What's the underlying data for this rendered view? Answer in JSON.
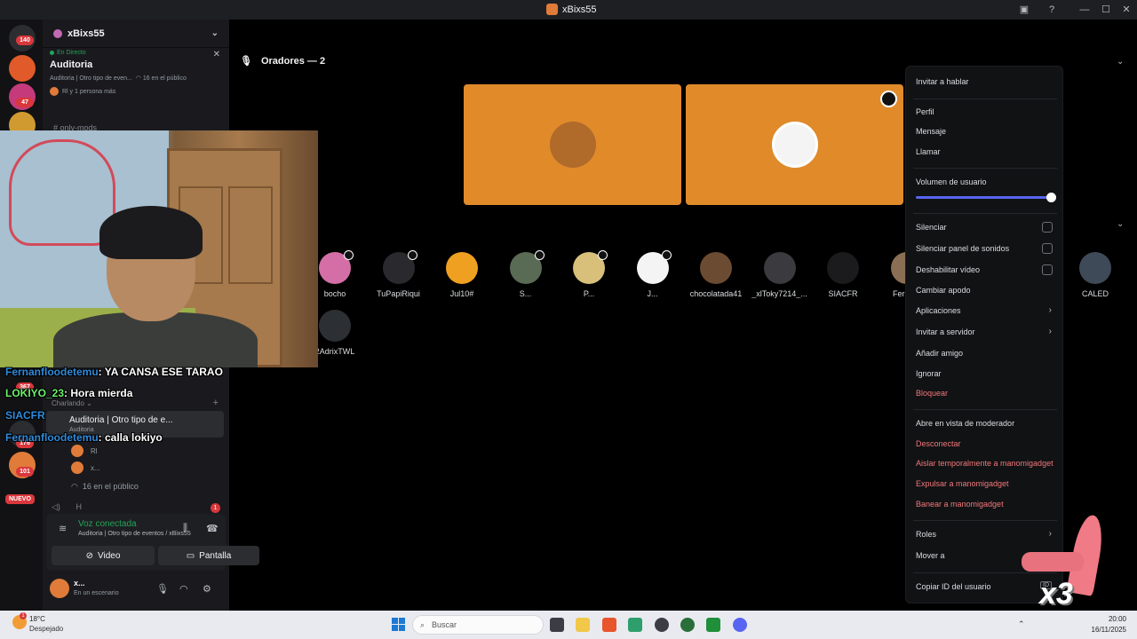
{
  "window": {
    "title": "xBixs55"
  },
  "rail": {
    "badges": [
      "140",
      "47",
      "367",
      "176",
      "101"
    ],
    "new_label": "NUEVO"
  },
  "sidebar": {
    "server_name": "xBixs55",
    "live": {
      "tag": "En Directo",
      "name": "Auditoria",
      "sub": "Auditoria | Otro tipo de even...",
      "listeners": "16 en el público",
      "people": "Rl y 1 persona más"
    },
    "channel_only_mods": "only-mods",
    "section_charlando": "Charlando",
    "stage_channel": {
      "name": "Auditoria | Otro tipo de e...",
      "sub": "Auditoria"
    },
    "users": [
      "Rl",
      "x..."
    ],
    "audience_count": "16 en el público",
    "last_channel": "H",
    "last_badge": "1"
  },
  "voice": {
    "title": "Voz conectada",
    "desc": "Auditoria | Otro tipo de eventos / xBixs55",
    "video_label": "Video",
    "screen_label": "Pantalla"
  },
  "user": {
    "name": "x...",
    "status": "En un escenario"
  },
  "stage": {
    "speakers_header": "Oradores — 2"
  },
  "audience": [
    {
      "name": "bocho",
      "color": "#d46ea6"
    },
    {
      "name": "TuPapiRiqui",
      "color": "#2a2a2e"
    },
    {
      "name": "Jul10#",
      "color": "#f0a020"
    },
    {
      "name": "S...",
      "color": "#5a6b55"
    },
    {
      "name": "P...",
      "color": "#d8c07a"
    },
    {
      "name": "J...",
      "color": "#f4f4f4"
    },
    {
      "name": "chocolatada41",
      "color": "#6b4c33"
    },
    {
      "name": "_xlToky7214_...",
      "color": "#3b3b3f"
    },
    {
      "name": "SIACFR",
      "color": "#1b1b1d"
    },
    {
      "name": "Fernanf",
      "color": "#8a6f55"
    },
    {
      "name": "CALED",
      "color": "#3f4a59"
    },
    {
      "name": "2AdrixTWL",
      "color": "#2c2f34"
    }
  ],
  "chat": [
    {
      "user": "Fernanfloodetemu",
      "msg": ": YA CANSA ESE TARAO",
      "green": false
    },
    {
      "user": "LOKIYO_23",
      "msg": ": Hora mierda",
      "green": true
    },
    {
      "user": "SIACFR",
      "msg": "",
      "green": false
    },
    {
      "user": "Fernanfloodetemu",
      "msg": ": calla lokiyo",
      "green": false
    }
  ],
  "context_menu": {
    "invite_speak": "Invitar a hablar",
    "profile": "Perfil",
    "message": "Mensaje",
    "call": "Llamar",
    "volume_label": "Volumen de usuario",
    "volume_level": 1.0,
    "mute": "Silenciar",
    "mute_soundboard": "Silenciar panel de sonidos",
    "disable_video": "Deshabilitar vídeo",
    "change_nick": "Cambiar apodo",
    "apps": "Aplicaciones",
    "invite_server": "Invitar a servidor",
    "add_friend": "Añadir amigo",
    "ignore": "Ignorar",
    "block": "Bloquear",
    "mod_view": "Abre en vista de moderador",
    "disconnect": "Desconectar",
    "timeout": "Aislar temporalmente a manomigadget",
    "kick": "Expulsar a manomigadget",
    "ban": "Banear a manomigadget",
    "roles": "Roles",
    "move_to": "Mover a",
    "copy_id": "Copiar ID del usuario",
    "id_badge": "ID"
  },
  "overlay": {
    "x3": "x3"
  },
  "taskbar": {
    "weather_badge": "1",
    "temp": "18°C",
    "weather_desc": "Despejado",
    "search_placeholder": "Buscar",
    "time": "20:00",
    "date": "16/11/2025"
  },
  "colors": {
    "accent": "#5865f2",
    "tile": "#e08a2a",
    "online": "#23a55a",
    "danger": "#f0787b"
  }
}
